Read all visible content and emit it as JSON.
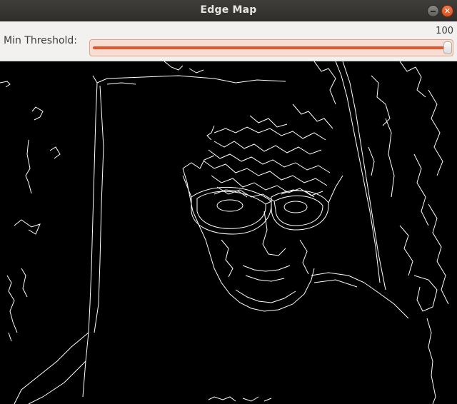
{
  "window": {
    "title": "Edge Map",
    "minimize_icon": "minimize-icon",
    "close_icon": "close-icon",
    "close_glyph": "✕"
  },
  "controls": {
    "slider_label": "Min Threshold:",
    "slider_value": "100",
    "slider_fraction": 1.0,
    "accent_color": "#e4572e"
  },
  "image": {
    "description_icon": "edge-map-image"
  }
}
